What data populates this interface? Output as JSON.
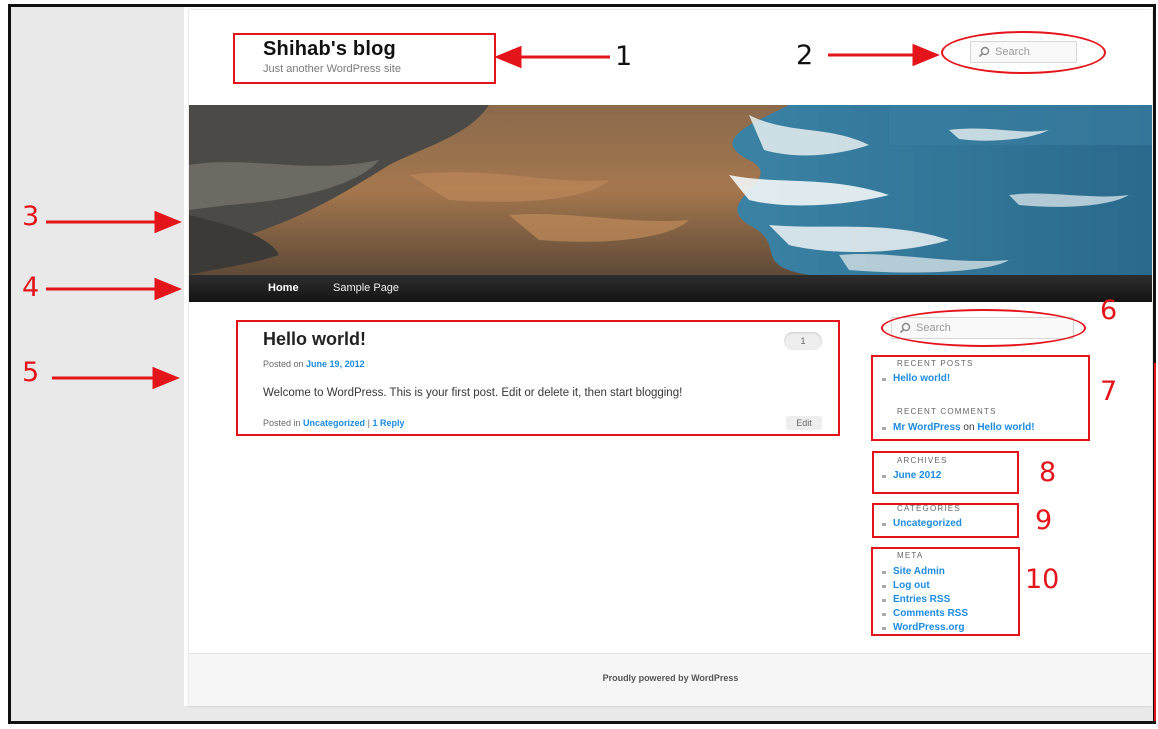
{
  "colors": {
    "link": "#1b8be0",
    "annotation": "#e4141b",
    "navbar": "#222222",
    "footer_bg": "#f6f6f6"
  },
  "header": {
    "title": "Shihab's blog",
    "description": "Just another WordPress site",
    "search_placeholder": "Search",
    "search_icon": "search-icon"
  },
  "nav": {
    "items": [
      {
        "label": "Home",
        "current": true
      },
      {
        "label": "Sample Page",
        "current": false
      }
    ]
  },
  "post": {
    "title": "Hello world!",
    "comment_count": "1",
    "posted_on_prefix": "Posted on",
    "date": "June 19, 2012",
    "body": "Welcome to WordPress. This is your first post. Edit or delete it, then start blogging!",
    "posted_in_prefix": "Posted in",
    "category": "Uncategorized",
    "separator": "|",
    "reply_link": "1 Reply",
    "edit_label": "Edit"
  },
  "sidebar": {
    "search_placeholder": "Search",
    "recent_posts": {
      "title": "RECENT POSTS",
      "items": [
        "Hello world!"
      ]
    },
    "recent_comments": {
      "title": "RECENT COMMENTS",
      "author": "Mr WordPress",
      "on": "on",
      "post": "Hello world!"
    },
    "archives": {
      "title": "ARCHIVES",
      "items": [
        "June 2012"
      ]
    },
    "categories": {
      "title": "CATEGORIES",
      "items": [
        "Uncategorized"
      ]
    },
    "meta": {
      "title": "META",
      "items": [
        "Site Admin",
        "Log out",
        "Entries RSS",
        "Comments RSS",
        "WordPress.org"
      ]
    }
  },
  "footer": {
    "text": "Proudly powered by WordPress"
  },
  "annotations": {
    "labels": [
      "1",
      "2",
      "3",
      "4",
      "5",
      "6",
      "7",
      "8",
      "9",
      "10"
    ]
  }
}
